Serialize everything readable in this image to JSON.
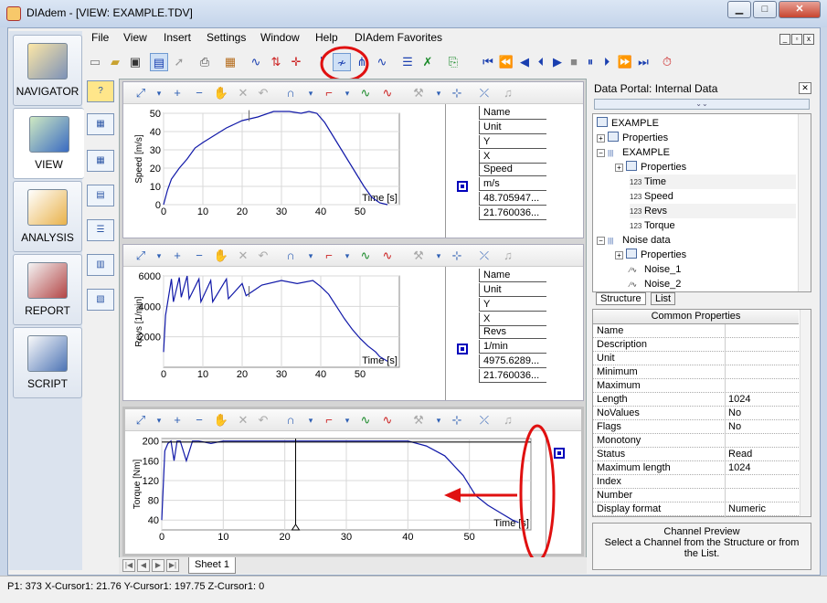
{
  "window": {
    "title": "DIAdem - [VIEW:  EXAMPLE.TDV]"
  },
  "nav": [
    {
      "label": "NAVIGATOR"
    },
    {
      "label": "VIEW"
    },
    {
      "label": "ANALYSIS"
    },
    {
      "label": "REPORT"
    },
    {
      "label": "SCRIPT"
    }
  ],
  "menu": [
    "File",
    "View",
    "Insert",
    "Settings",
    "Window",
    "Help",
    "DIAdem Favorites"
  ],
  "charts": [
    {
      "ylabel": "Speed [m/s]",
      "xlabel": "Time [s]",
      "yticks": [
        "0",
        "10",
        "20",
        "30",
        "40",
        "50"
      ],
      "xticks": [
        "0",
        "10",
        "20",
        "30",
        "40",
        "50"
      ],
      "table": {
        "header": [
          "Name",
          "Unit",
          "Y",
          "X"
        ],
        "values": [
          "Speed",
          "m/s",
          "48.705947...",
          "21.760036..."
        ]
      }
    },
    {
      "ylabel": "Revs [1/min]",
      "xlabel": "Time [s]",
      "yticks": [
        "2000",
        "4000",
        "6000"
      ],
      "xticks": [
        "0",
        "10",
        "20",
        "30",
        "40",
        "50"
      ],
      "table": {
        "header": [
          "Name",
          "Unit",
          "Y",
          "X"
        ],
        "values": [
          "Revs",
          "1/min",
          "4975.6289...",
          "21.760036..."
        ]
      }
    },
    {
      "ylabel": "Torque [Nm]",
      "xlabel": "Time [s]",
      "yticks": [
        "40",
        "80",
        "120",
        "160",
        "200"
      ],
      "xticks": [
        "0",
        "10",
        "20",
        "30",
        "40",
        "50"
      ]
    }
  ],
  "chart_data": [
    {
      "type": "line",
      "xlabel": "Time [s]",
      "ylabel": "Speed [m/s]",
      "xlim": [
        0,
        60
      ],
      "ylim": [
        0,
        50
      ],
      "series": [
        {
          "x": [
            0,
            1,
            2,
            4,
            6,
            8,
            10,
            13,
            16,
            20,
            24,
            28,
            32,
            35,
            37,
            39,
            41,
            43,
            45,
            47,
            49,
            51,
            53,
            55,
            57
          ],
          "y": [
            0,
            8,
            14,
            20,
            25,
            31,
            34,
            38,
            42,
            46,
            48,
            51,
            51,
            50,
            51,
            50,
            45,
            38,
            31,
            24,
            17,
            10,
            4,
            1,
            0
          ]
        }
      ]
    },
    {
      "type": "line",
      "xlabel": "Time [s]",
      "ylabel": "Revs [1/min]",
      "xlim": [
        0,
        60
      ],
      "ylim": [
        0,
        6000
      ],
      "series": [
        {
          "x": [
            0,
            0.5,
            2,
            2.5,
            4,
            4.5,
            6,
            6.5,
            9,
            9.5,
            12,
            12.5,
            16,
            16.5,
            20,
            21,
            25,
            30,
            34,
            38,
            40,
            42,
            44,
            46,
            48,
            50,
            52,
            54,
            55,
            57
          ],
          "y": [
            1000,
            3400,
            5800,
            4300,
            5900,
            4600,
            6000,
            4500,
            5800,
            4300,
            5700,
            4300,
            5800,
            4500,
            5500,
            4700,
            5400,
            5700,
            5500,
            5700,
            5300,
            4800,
            4000,
            3200,
            2500,
            1900,
            1400,
            1000,
            700,
            400
          ]
        }
      ]
    },
    {
      "type": "line",
      "xlabel": "Time [s]",
      "ylabel": "Torque [Nm]",
      "xlim": [
        0,
        60
      ],
      "ylim": [
        20,
        205
      ],
      "series": [
        {
          "x": [
            0,
            0.5,
            1,
            1.5,
            2,
            2.5,
            3,
            4,
            5,
            6,
            8,
            10,
            20,
            30,
            40,
            43,
            46,
            49,
            51,
            53,
            55,
            57,
            58
          ],
          "y": [
            40,
            180,
            195,
            200,
            160,
            200,
            200,
            160,
            200,
            200,
            195,
            200,
            200,
            200,
            200,
            190,
            170,
            130,
            90,
            70,
            55,
            40,
            35
          ]
        }
      ]
    }
  ],
  "portal": {
    "title": "Data Portal: Internal Data",
    "tree": [
      "EXAMPLE",
      "Properties",
      "EXAMPLE",
      "Properties",
      "Time",
      "Speed",
      "Revs",
      "Torque",
      "Noise data",
      "Properties",
      "Noise_1",
      "Noise_2"
    ],
    "tabs": [
      "Structure",
      "List"
    ],
    "props_header": "Common Properties",
    "props": [
      {
        "k": "Name",
        "v": ""
      },
      {
        "k": "Description",
        "v": ""
      },
      {
        "k": "Unit",
        "v": ""
      },
      {
        "k": "Minimum",
        "v": ""
      },
      {
        "k": "Maximum",
        "v": ""
      },
      {
        "k": "Length",
        "v": "1024"
      },
      {
        "k": "NoValues",
        "v": "No"
      },
      {
        "k": "Flags",
        "v": "No"
      },
      {
        "k": "Monotony",
        "v": ""
      },
      {
        "k": "Status",
        "v": "Read"
      },
      {
        "k": "Maximum length",
        "v": "1024"
      },
      {
        "k": "Index",
        "v": ""
      },
      {
        "k": "Number",
        "v": ""
      },
      {
        "k": "Display format",
        "v": "Numeric"
      }
    ],
    "preview_title": "Channel Preview",
    "preview_text": "Select a Channel from the Structure or from the List."
  },
  "sheet_tab": "Sheet 1",
  "status": "P1: 373 X-Cursor1: 21.76 Y-Cursor1: 197.75 Z-Cursor1: 0",
  "colors": {
    "curve": "#1018a8",
    "annotation": "#e01010",
    "grid": "#d8d8d8"
  }
}
